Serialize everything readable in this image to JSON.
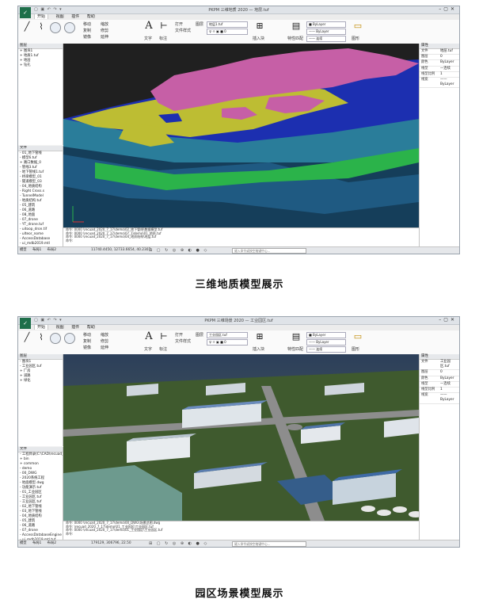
{
  "screenshot1": {
    "app_title": "PKPM 三维地质 2020 — 地层.tuf",
    "menu": [
      "开始",
      "视图",
      "插件",
      "帮助"
    ],
    "ribbon_labels": [
      "移动",
      "复制",
      "镜像",
      "缩放",
      "修剪",
      "延伸",
      "文字",
      "标注",
      "打开",
      "文件样式",
      "图层",
      "插入块",
      "特性匹配",
      "图形"
    ],
    "layer_select": "地层1.tuf",
    "left_panel_title": "图层",
    "layer_tree": [
      "+ 图块1",
      "+ 地质1.tuf",
      "  + 地层",
      "  + 钻孔"
    ],
    "file_panel_title": "文件",
    "file_tree": [
      "- 01_地下管线",
      "  - 模型6.tuf",
      "  + 路口数据_0",
      "  - 管线3.tuf",
      "  - 地下管线1.tuf",
      "  - 桥梁模型_01",
      "  - 隧道模型_03",
      "- 04_地质结构",
      "  - Right Cross.s",
      "  - TunnelModel",
      "  - 地质结构.tuf",
      "- 05_建筑",
      "- 06_道路",
      "- 08_地面",
      "  - 07_drone",
      "  - YT_drone.tuf",
      "  - uitoop_dron.tif",
      "  - ulteor_nome",
      "- AccessDatabase",
      "- ui_mdb2019.mtl"
    ],
    "props_title": "属性",
    "props": [
      [
        "文件",
        "地层.tuf"
      ],
      [
        "图层",
        "0"
      ],
      [
        "颜色",
        "ByLayer"
      ],
      [
        "线型",
        "—连续"
      ],
      [
        "线型比例",
        "1"
      ],
      [
        "线宽",
        "—— ByLayer"
      ]
    ],
    "cmd_lines": [
      "命令: 0000 \\recuad_2020_7_17\\demo\\02_地下管线\\数据模型.tuf",
      "命令: 0000 \\recuad_2020_7_17\\demo\\07_1\\demo\\01_地质.tuf",
      "命令: 0000 \\recuad_2020_7_17\\demo\\04_地质结构\\地层.tuf",
      "命令:"
    ],
    "status_tabs": [
      "模型",
      "布局1",
      "布局2"
    ],
    "coords": "11740.4450, 12733.6654, 40.2307",
    "hint": "键入命令或按空格键中心..."
  },
  "caption1": "三维地质模型展示",
  "screenshot2": {
    "app_title": "PKPM 三维场景 2020 — 工业园区.tuf",
    "menu": [
      "开始",
      "视图",
      "插件",
      "帮助"
    ],
    "ribbon_labels": [
      "移动",
      "复制",
      "镜像",
      "缩放",
      "修剪",
      "延伸",
      "文字",
      "标注",
      "打开",
      "文件样式",
      "图层",
      "插入块",
      "特性匹配",
      "图形"
    ],
    "layer_select": "工业园区.tuf",
    "left_panel_title": "图层",
    "layer_tree": [
      "- 图块1",
      "- 工业园区.tuf",
      "  + 厂房",
      "  + 道路",
      "  + 绿化"
    ],
    "file_panel_title": "文件",
    "file_tree": [
      "- 工程目录(C:\\CAD\\recuad_2",
      "  + bin",
      "  + common",
      "  - demo",
      "    - 00_DWG",
      "    - 2020系统工程",
      "    - 地面模型.dwg",
      "    - 功能演示.tuf",
      "  - 01_工业园区",
      "    - 工业园区.tuf",
      "    - 工业园区.tuf",
      "  - 02_地下管线",
      "  - 03_地下管线",
      "  - 04_地质结构",
      "  - 05_建筑",
      "  - 06_道路",
      "  - 07_drone",
      "  - AccessDatabaseEngine",
      "  - ui_mdb2019.mtl.tuf"
    ],
    "props_title": "属性",
    "props": [
      [
        "文件",
        "工业园区.tuf"
      ],
      [
        "图层",
        "0"
      ],
      [
        "颜色",
        "ByLayer"
      ],
      [
        "线型",
        "—连续"
      ],
      [
        "线型比例",
        "1"
      ],
      [
        "线宽",
        "—— ByLayer"
      ]
    ],
    "cmd_lines": [
      "命令: 0000 \\recuad_2020_7_17\\demo\\00_DWG\\场景总图.dwg",
      "命令: \\recuad_2020_7_17\\demo\\01_工业园区\\工业园区.tuf",
      "命令: 0000 \\recuad_2020_7_17\\demo\\01_工业园区\\工业园区.tuf",
      "命令:"
    ],
    "status_tabs": [
      "模型",
      "布局1",
      "布局2"
    ],
    "coords": "179129, 306796, 22.50",
    "hint": "键入命令或按空格键中心..."
  },
  "caption2": "园区场景模型展示",
  "colors": {
    "geology_pink": "#c65fa6",
    "geology_yellow": "#bdbd33",
    "geology_blue": "#1c2fb0",
    "geology_teal": "#2a7d9a",
    "geology_green": "#2bb34a",
    "view_bg": "#202020"
  }
}
